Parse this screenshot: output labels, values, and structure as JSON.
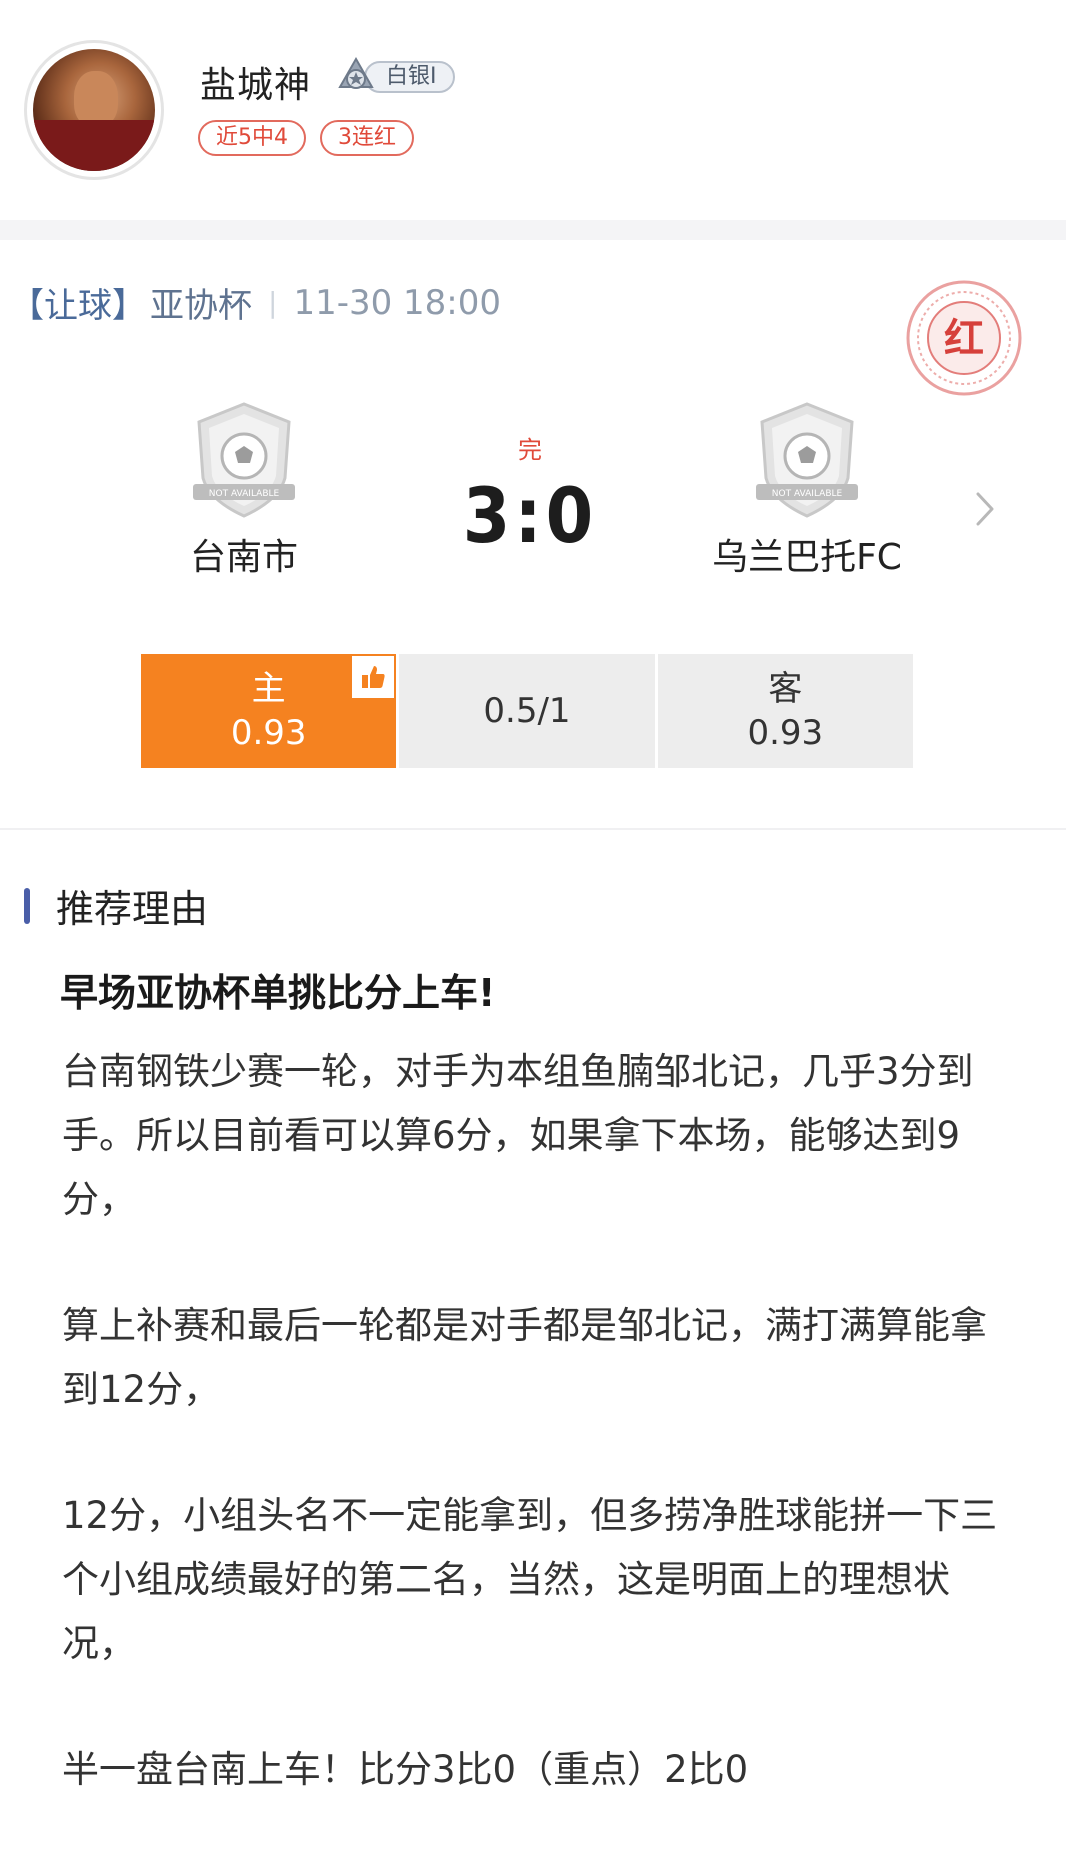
{
  "profile": {
    "username": "盐城神",
    "rank": "白银Ⅰ",
    "tags": [
      "近5中4",
      "3连红"
    ]
  },
  "match": {
    "bet_type": "【让球】",
    "league": "亚协杯",
    "separator": "|",
    "time": "11-30  18:00",
    "stamp_text": "红",
    "status": "完",
    "score": "3:0",
    "home_team": "台南市",
    "away_team": "乌兰巴托FC",
    "logo_caption": "NOT AVAILABLE",
    "odds": {
      "home_label": "主",
      "home_value": "0.93",
      "handicap": "0.5/1",
      "away_label": "客",
      "away_value": "0.93"
    },
    "selected_side": "home"
  },
  "reason": {
    "section_title": "推荐理由",
    "headline": "早场亚协杯单挑比分上车!",
    "paragraphs": [
      "台南钢铁少赛一轮，对手为本组鱼腩邹北记，几乎3分到手。所以目前看可以算6分，如果拿下本场，能够达到9分，",
      "算上补赛和最后一轮都是对手都是邹北记，满打满算能拿到12分，",
      "12分，小组头名不一定能拿到，但多捞净胜球能拼一下三个小组成绩最好的第二名，当然，这是明面上的理想状况，",
      "半一盘台南上车！比分3比0（重点）2比0"
    ]
  },
  "colors": {
    "accent_orange": "#f58220",
    "win_red": "#e04a3a",
    "section_bar": "#4a5ea8",
    "meta_blue": "#5f7390"
  }
}
